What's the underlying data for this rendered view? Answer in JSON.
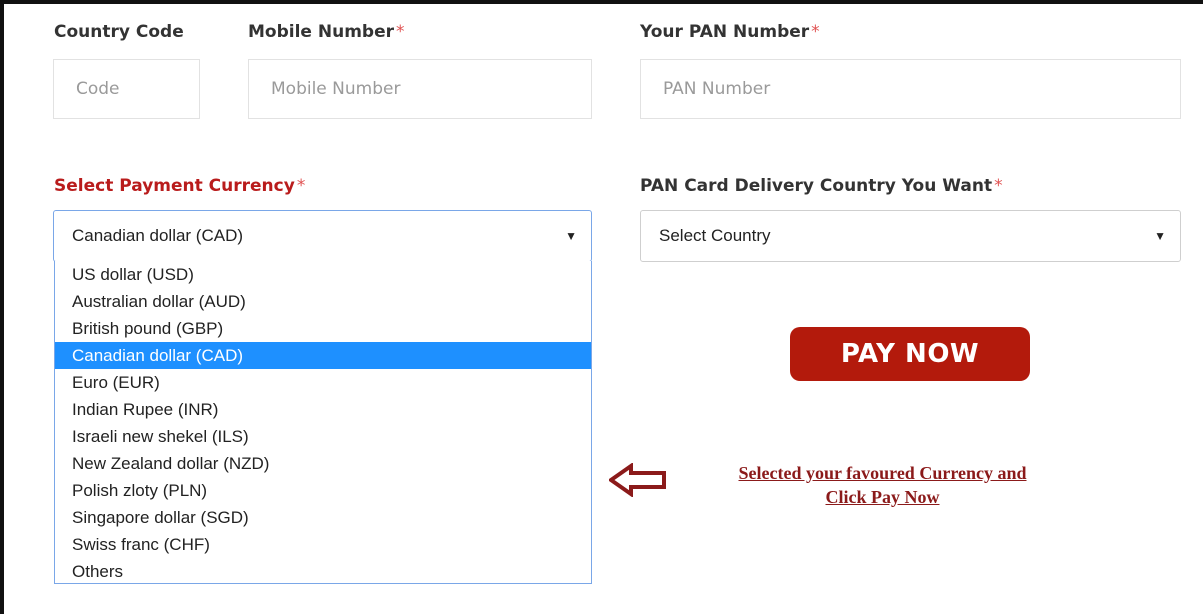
{
  "fields": {
    "country_code": {
      "label": "Country Code",
      "placeholder": "Code"
    },
    "mobile": {
      "label": "Mobile Number",
      "required": "*",
      "placeholder": "Mobile Number"
    },
    "pan": {
      "label": "Your PAN Number",
      "required": "*",
      "placeholder": "PAN Number"
    }
  },
  "currency": {
    "label": "Select Payment Currency",
    "required": "*",
    "selected": "Canadian dollar (CAD)",
    "options": [
      "US dollar (USD)",
      "Australian dollar (AUD)",
      "British pound (GBP)",
      "Canadian dollar (CAD)",
      "Euro (EUR)",
      "Indian Rupee (INR)",
      "Israeli new shekel (ILS)",
      "New Zealand dollar (NZD)",
      "Polish zloty (PLN)",
      "Singapore dollar (SGD)",
      "Swiss franc (CHF)",
      "Others"
    ],
    "arrow": "▼"
  },
  "delivery": {
    "label": "PAN Card Delivery Country You Want",
    "required": "*",
    "selected": "Select Country",
    "arrow": "▼"
  },
  "pay_button": {
    "label": "PAY NOW",
    "color": "#b31a0c"
  },
  "annotation": {
    "line1": "Selected your favoured Currency and",
    "line2": "Click Pay Now",
    "icon": "left-arrow-icon",
    "color": "#8b1a1a"
  },
  "colors": {
    "highlight": "#1e90ff",
    "required_star": "#e05252",
    "currency_label": "#b91c1c"
  }
}
